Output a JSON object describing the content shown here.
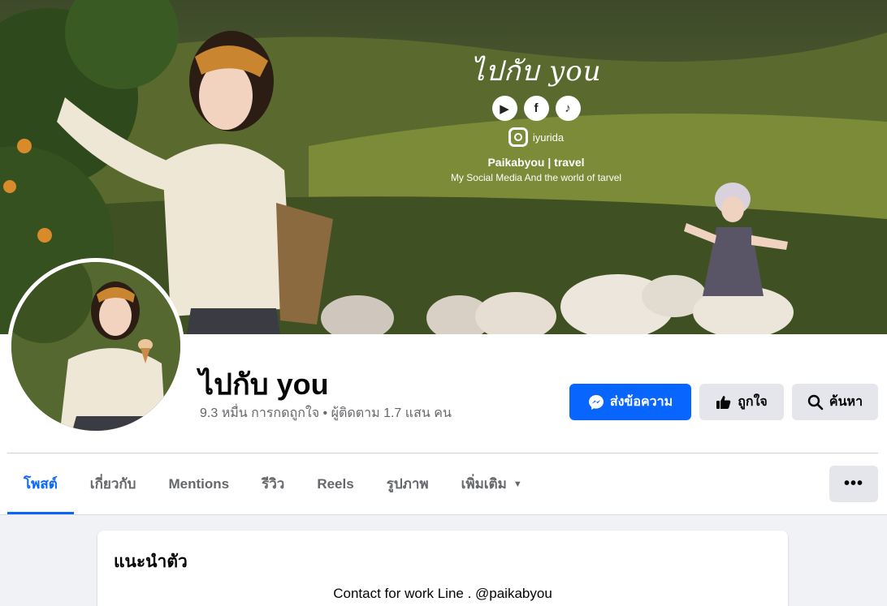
{
  "cover": {
    "brand_script": "ไปกับ you",
    "social_icons": [
      "youtube-icon",
      "facebook-icon",
      "tiktok-icon"
    ],
    "instagram_handle": "iyurida",
    "tagline": "Paikabyou | travel",
    "subtitle": "My Social Media And the world of tarvel"
  },
  "profile": {
    "name": "ไปกับ you",
    "stats": "9.3 หมื่น การกดถูกใจ • ผู้ติดตาม 1.7 แสน คน"
  },
  "actions": {
    "message_label": "ส่งข้อความ",
    "like_label": "ถูกใจ",
    "search_label": "ค้นหา"
  },
  "tabs": [
    {
      "label": "โพสต์",
      "active": true
    },
    {
      "label": "เกี่ยวกับ"
    },
    {
      "label": "Mentions"
    },
    {
      "label": "รีวิว"
    },
    {
      "label": "Reels"
    },
    {
      "label": "รูปภาพ"
    },
    {
      "label": "เพิ่มเติม"
    }
  ],
  "more_menu": "•••",
  "intro": {
    "title": "แนะนำตัว",
    "bio": "Contact for work Line . @paikabyou"
  },
  "colors": {
    "accent": "#0866ff",
    "button_gray": "#e4e6eb",
    "muted_text": "#65676b",
    "background": "#f0f2f5"
  }
}
